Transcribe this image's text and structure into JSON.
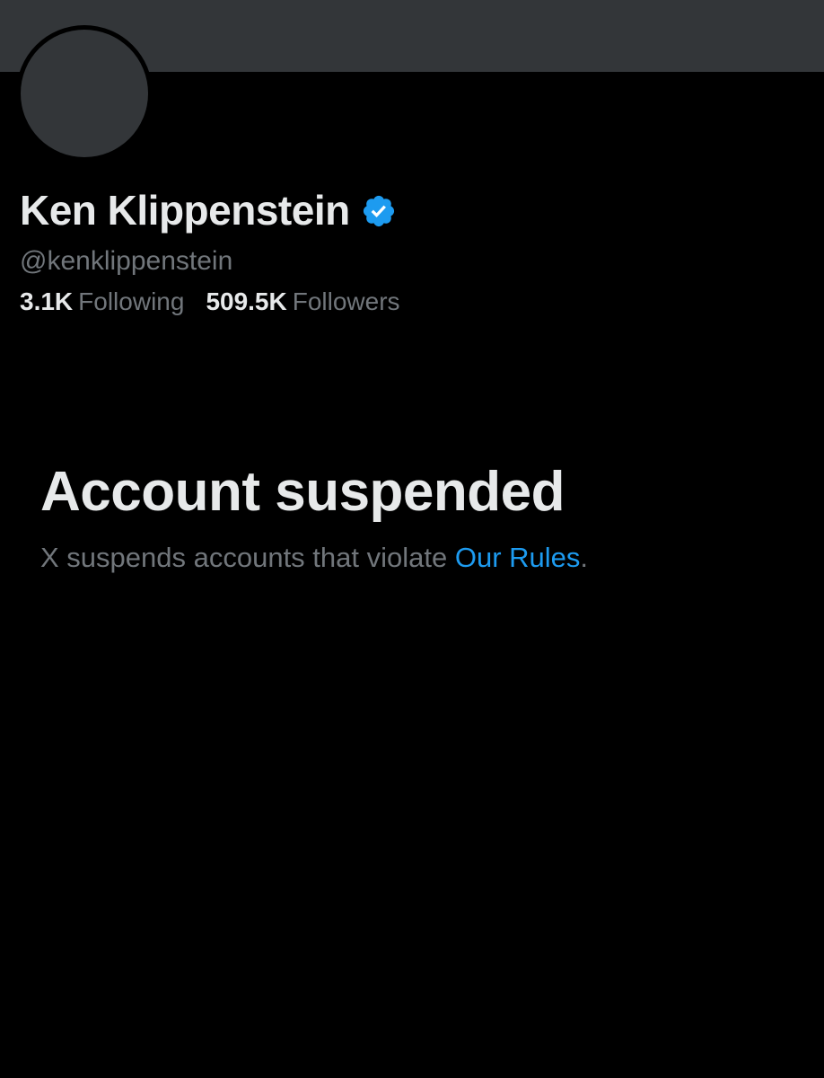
{
  "profile": {
    "display_name": "Ken Klippenstein",
    "handle": "@kenklippenstein",
    "verified_icon": "verified-badge-icon",
    "stats": {
      "following_count": "3.1K",
      "following_label": "Following",
      "followers_count": "509.5K",
      "followers_label": "Followers"
    }
  },
  "suspension": {
    "title": "Account suspended",
    "description_prefix": "X suspends accounts that violate ",
    "rules_link": "Our Rules",
    "description_suffix": "."
  },
  "colors": {
    "background": "#000000",
    "banner": "#333639",
    "text_primary": "#e7e9ea",
    "text_secondary": "#71767b",
    "accent": "#1d9bf0"
  }
}
